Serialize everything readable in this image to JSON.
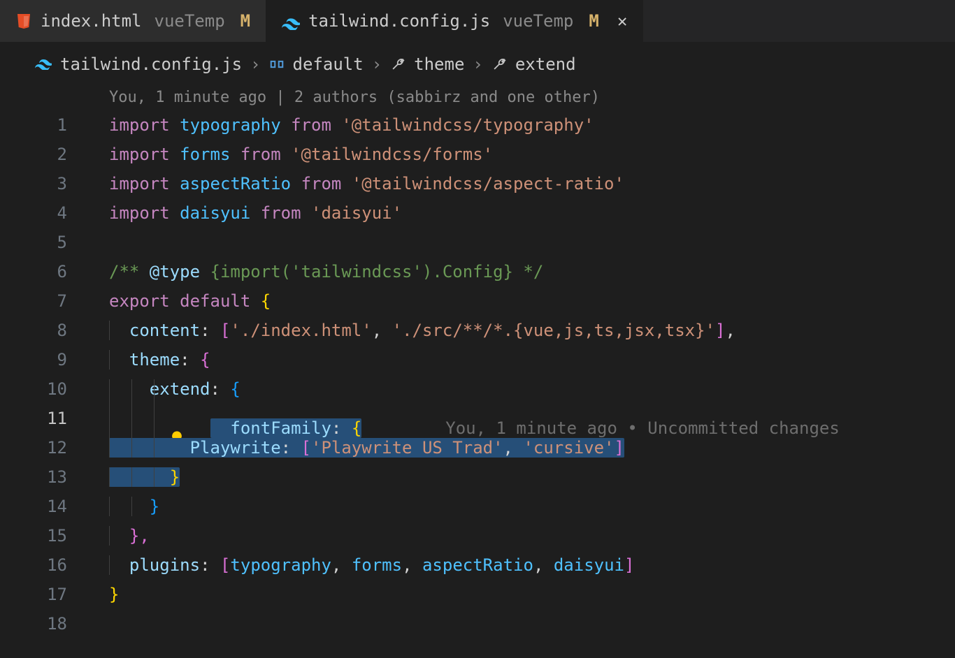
{
  "tabs": [
    {
      "file": "index.html",
      "dir": "vueTemp",
      "mod": "M",
      "active": false,
      "icon": "html5"
    },
    {
      "file": "tailwind.config.js",
      "dir": "vueTemp",
      "mod": "M",
      "active": true,
      "icon": "tailwind"
    }
  ],
  "breadcrumb": {
    "file": "tailwind.config.js",
    "seg1": "default",
    "seg2": "theme",
    "seg3": "extend"
  },
  "lens": "You, 1 minute ago | 2 authors (sabbirz and one other)",
  "inline_lens": "You, 1 minute ago • Uncommitted changes",
  "lines": {
    "l1": {
      "n": "1"
    },
    "l2": {
      "n": "2"
    },
    "l3": {
      "n": "3"
    },
    "l4": {
      "n": "4"
    },
    "l5": {
      "n": "5"
    },
    "l6": {
      "n": "6"
    },
    "l7": {
      "n": "7"
    },
    "l8": {
      "n": "8"
    },
    "l9": {
      "n": "9"
    },
    "l10": {
      "n": "10"
    },
    "l11": {
      "n": "11"
    },
    "l12": {
      "n": "12"
    },
    "l13": {
      "n": "13"
    },
    "l14": {
      "n": "14"
    },
    "l15": {
      "n": "15"
    },
    "l16": {
      "n": "16"
    },
    "l17": {
      "n": "17"
    },
    "l18": {
      "n": "18"
    }
  },
  "tok": {
    "import": "import",
    "from": "from",
    "typography": "typography",
    "forms": "forms",
    "aspectRatio": "aspectRatio",
    "daisyui": "daisyui",
    "pkg_typo": "'@tailwindcss/typography'",
    "pkg_forms": "'@tailwindcss/forms'",
    "pkg_ar": "'@tailwindcss/aspect-ratio'",
    "pkg_daisy": "'daisyui'",
    "cmt_open": "/** ",
    "cmt_at": "@type",
    "cmt_body": " {import('tailwindcss').Config} ",
    "cmt_close": "*/",
    "export": "export",
    "default": "default",
    "content": "content",
    "theme": "theme",
    "extend": "extend",
    "fontFamily": "fontFamily",
    "Playwrite": "Playwrite",
    "plugins": "plugins",
    "content_arr_a": "'./index.html'",
    "content_arr_b": "'./src/**/*.{vue,js,ts,jsx,tsx}'",
    "pw_a": "'Playwrite US Trad'",
    "pw_b": "'cursive'",
    "colon_sp": ": ",
    "comma_sp": ", ",
    "lbr_y": "{",
    "rbr_y": "}",
    "lbr_pk": "{",
    "rbr_pk": "}",
    "lbr_bl": "{",
    "rbr_bl": "}",
    "lsq_pk": "[",
    "rsq_pk": "]",
    "lsq_y": "[",
    "rsq_y": "]",
    "comma": ",",
    "rbr_y_comma": "},"
  }
}
